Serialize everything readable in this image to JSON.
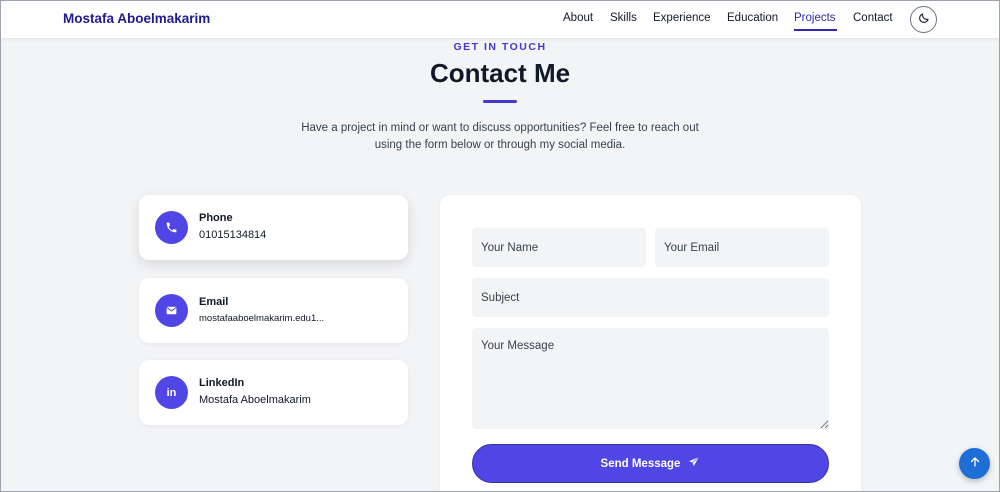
{
  "nav": {
    "brand": "Mostafa Aboelmakarim",
    "links": [
      {
        "label": "About"
      },
      {
        "label": "Skills"
      },
      {
        "label": "Experience"
      },
      {
        "label": "Education"
      },
      {
        "label": "Projects",
        "active": true
      },
      {
        "label": "Contact"
      }
    ],
    "theme_toggle_icon": "moon-icon"
  },
  "contact": {
    "kicker": "GET IN TOUCH",
    "title": "Contact Me",
    "subtitle_line1": "Have a project in mind or want to discuss opportunities? Feel free to reach out",
    "subtitle_line2": "using the form below or through my social media."
  },
  "cards": {
    "phone": {
      "label": "Phone",
      "value": "01015134814",
      "icon": "phone-icon"
    },
    "email": {
      "label": "Email",
      "value": "mostafaaboelmakarim.edu1...",
      "icon": "envelope-icon"
    },
    "linkedin": {
      "label": "LinkedIn",
      "value": "Mostafa Aboelmakarim",
      "icon": "linkedin-icon"
    }
  },
  "form": {
    "name_placeholder": "Your Name",
    "email_placeholder": "Your Email",
    "subject_placeholder": "Subject",
    "message_placeholder": "Your Message",
    "send_label": "Send Message",
    "send_icon": "paper-plane-icon"
  },
  "scroll_top_icon": "arrow-up-icon",
  "colors": {
    "brand": "#1e1b8f",
    "accent": "#4f46e5",
    "active_link": "#2f2aa8",
    "page_bg": "#f3f4f6",
    "scroll_top": "#1d6fd6"
  }
}
